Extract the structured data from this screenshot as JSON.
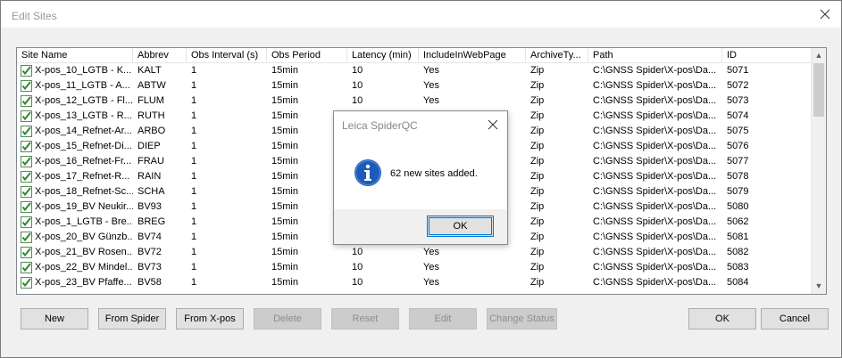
{
  "window": {
    "title": "Edit Sites"
  },
  "columns": [
    {
      "label": "Site Name"
    },
    {
      "label": "Abbrev"
    },
    {
      "label": "Obs Interval (s)"
    },
    {
      "label": "Obs Period"
    },
    {
      "label": "Latency (min)"
    },
    {
      "label": "IncludeInWebPage"
    },
    {
      "label": "ArchiveTy..."
    },
    {
      "label": "Path"
    },
    {
      "label": "ID"
    }
  ],
  "rows": [
    [
      "X-pos_10_LGTB - K...",
      "KALT",
      "1",
      "15min",
      "10",
      "Yes",
      "Zip",
      "C:\\GNSS Spider\\X-pos\\Da...",
      "5071"
    ],
    [
      "X-pos_11_LGTB - A...",
      "ABTW",
      "1",
      "15min",
      "10",
      "Yes",
      "Zip",
      "C:\\GNSS Spider\\X-pos\\Da...",
      "5072"
    ],
    [
      "X-pos_12_LGTB - Fl...",
      "FLUM",
      "1",
      "15min",
      "10",
      "Yes",
      "Zip",
      "C:\\GNSS Spider\\X-pos\\Da...",
      "5073"
    ],
    [
      "X-pos_13_LGTB - R...",
      "RUTH",
      "1",
      "15min",
      "",
      "",
      "Zip",
      "C:\\GNSS Spider\\X-pos\\Da...",
      "5074"
    ],
    [
      "X-pos_14_Refnet-Ar...",
      "ARBO",
      "1",
      "15min",
      "",
      "",
      "Zip",
      "C:\\GNSS Spider\\X-pos\\Da...",
      "5075"
    ],
    [
      "X-pos_15_Refnet-Di...",
      "DIEP",
      "1",
      "15min",
      "",
      "",
      "Zip",
      "C:\\GNSS Spider\\X-pos\\Da...",
      "5076"
    ],
    [
      "X-pos_16_Refnet-Fr...",
      "FRAU",
      "1",
      "15min",
      "",
      "",
      "Zip",
      "C:\\GNSS Spider\\X-pos\\Da...",
      "5077"
    ],
    [
      "X-pos_17_Refnet-R...",
      "RAIN",
      "1",
      "15min",
      "",
      "",
      "Zip",
      "C:\\GNSS Spider\\X-pos\\Da...",
      "5078"
    ],
    [
      "X-pos_18_Refnet-Sc...",
      "SCHA",
      "1",
      "15min",
      "",
      "",
      "Zip",
      "C:\\GNSS Spider\\X-pos\\Da...",
      "5079"
    ],
    [
      "X-pos_19_BV Neukir...",
      "BV93",
      "1",
      "15min",
      "",
      "",
      "Zip",
      "C:\\GNSS Spider\\X-pos\\Da...",
      "5080"
    ],
    [
      "X-pos_1_LGTB - Bre...",
      "BREG",
      "1",
      "15min",
      "",
      "",
      "Zip",
      "C:\\GNSS Spider\\X-pos\\Da...",
      "5062"
    ],
    [
      "X-pos_20_BV Günzb...",
      "BV74",
      "1",
      "15min",
      "",
      "",
      "Zip",
      "C:\\GNSS Spider\\X-pos\\Da...",
      "5081"
    ],
    [
      "X-pos_21_BV Rosen...",
      "BV72",
      "1",
      "15min",
      "10",
      "Yes",
      "Zip",
      "C:\\GNSS Spider\\X-pos\\Da...",
      "5082"
    ],
    [
      "X-pos_22_BV Mindel...",
      "BV73",
      "1",
      "15min",
      "10",
      "Yes",
      "Zip",
      "C:\\GNSS Spider\\X-pos\\Da...",
      "5083"
    ],
    [
      "X-pos_23_BV Pfaffe...",
      "BV58",
      "1",
      "15min",
      "10",
      "Yes",
      "Zip",
      "C:\\GNSS Spider\\X-pos\\Da...",
      "5084"
    ]
  ],
  "buttons": {
    "new": "New",
    "from_spider": "From Spider",
    "from_xpos": "From X-pos",
    "delete": "Delete",
    "reset": "Reset",
    "edit": "Edit",
    "change_status": "Change Status",
    "ok": "OK",
    "cancel": "Cancel"
  },
  "dialog": {
    "title": "Leica SpiderQC",
    "message": "62 new sites added.",
    "ok": "OK",
    "icon": "info-icon"
  },
  "icons": {
    "row_check": "checked-checkbox-icon",
    "close": "close-icon"
  },
  "colors": {
    "check_green": "#2e8b2e",
    "info_blue": "#1c5bb8",
    "focus_blue": "#0078d7"
  }
}
